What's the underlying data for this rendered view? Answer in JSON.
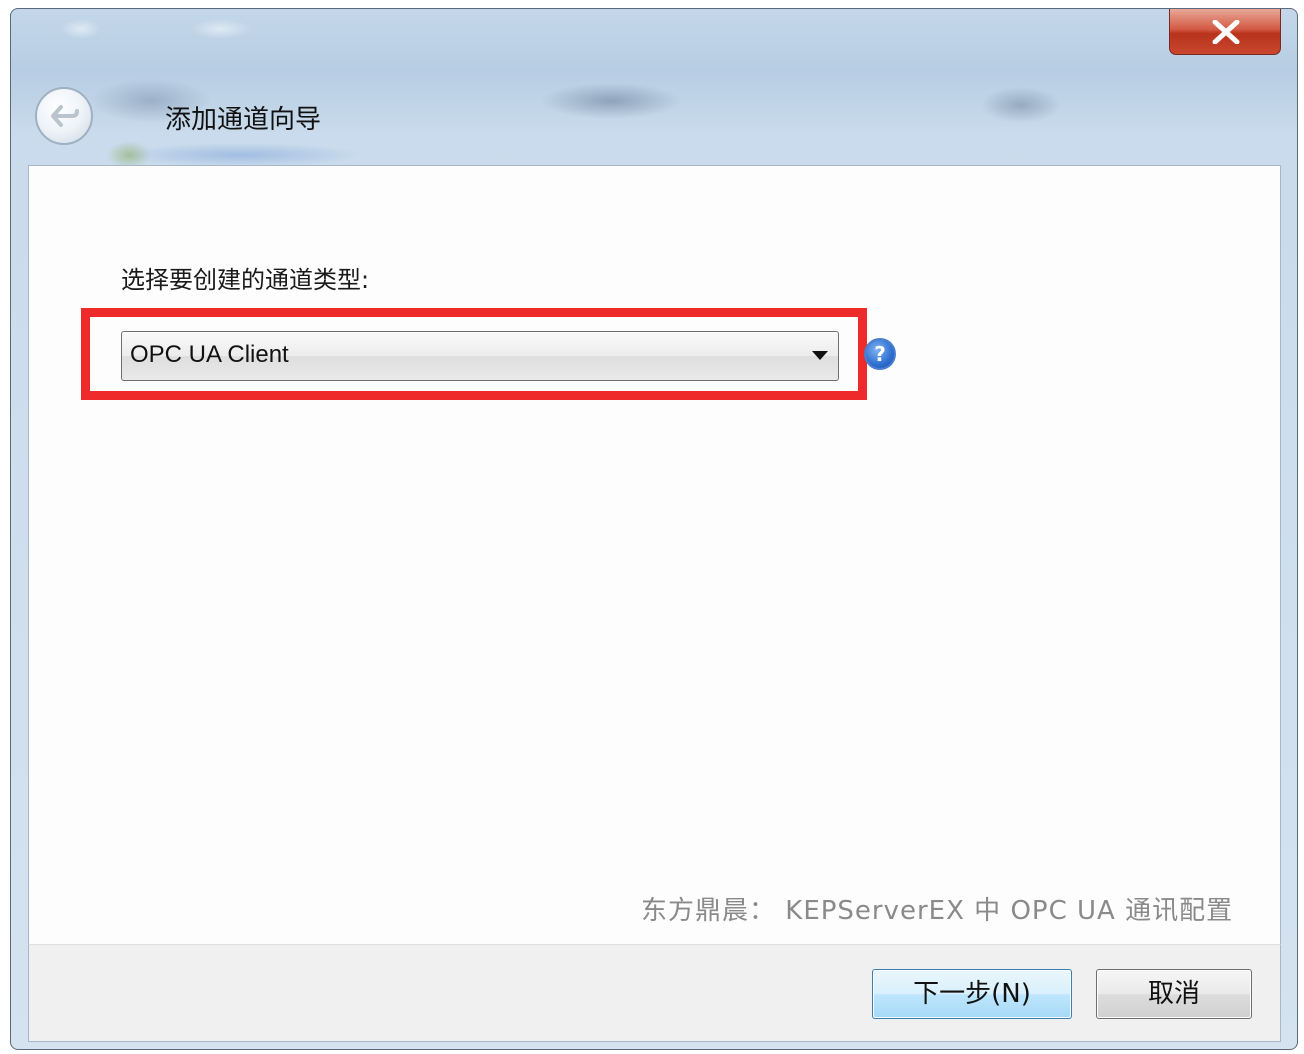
{
  "window": {
    "title": "添加通道向导",
    "close_glyph": "X"
  },
  "content": {
    "prompt": "选择要创建的通道类型:",
    "channel_type_select": {
      "value": "OPC UA Client"
    },
    "help_glyph": "?"
  },
  "watermark": "东方鼎晨： KEPServerEX 中 OPC UA 通讯配置",
  "footer": {
    "next_label": "下一步(N)",
    "cancel_label": "取消"
  },
  "colors": {
    "highlight": "#ee2a2a",
    "close_button": "#c9482e",
    "help_icon": "#2f6fd1",
    "next_button_border": "#3c7fb1"
  },
  "icons": [
    "close-icon",
    "back-arrow-icon",
    "dropdown-arrow-icon",
    "help-icon"
  ]
}
